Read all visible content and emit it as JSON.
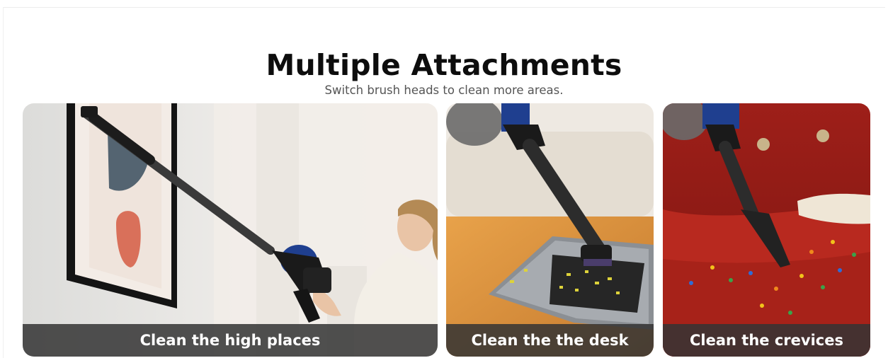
{
  "heading": {
    "title": "Multiple Attachments",
    "subtitle": "Switch brush heads to clean more areas."
  },
  "panels": [
    {
      "caption": "Clean the high places",
      "scene": "wall-art-vacuum"
    },
    {
      "caption": "Clean the the desk",
      "scene": "laptop-keyboard-vacuum"
    },
    {
      "caption": "Clean the crevices",
      "scene": "red-sofa-vacuum"
    }
  ],
  "colors": {
    "caption_bar": "#343434",
    "caption_text": "#ffffff",
    "vacuum_blue": "#1f3f8f",
    "sofa_red": "#a3201a"
  }
}
